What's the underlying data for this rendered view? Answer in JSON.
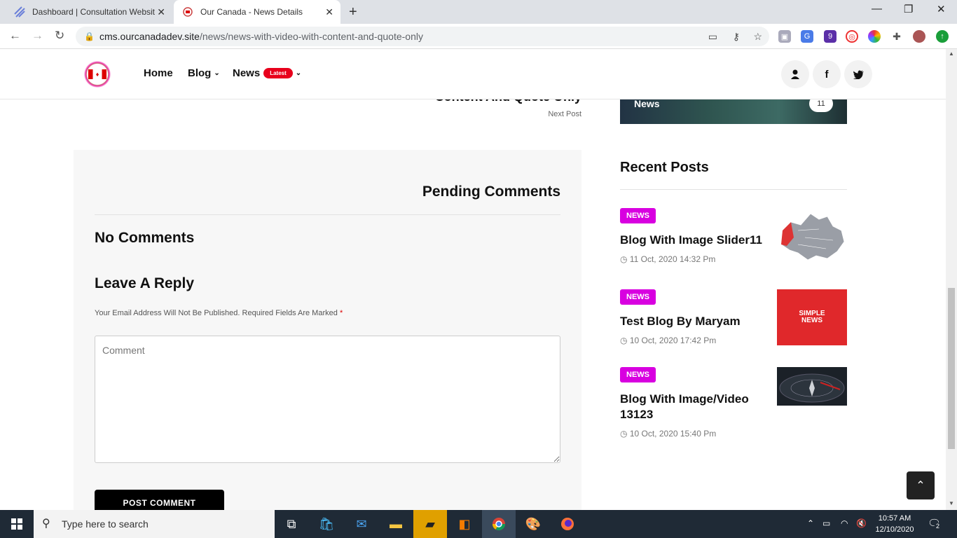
{
  "browser": {
    "tabs": [
      {
        "title": "Dashboard | Consultation Websit",
        "active": false
      },
      {
        "title": "Our Canada - News Details",
        "active": true
      }
    ],
    "url_host": "cms.ourcanadadev.site",
    "url_path": "/news/news-with-video-with-content-and-quote-only",
    "extension_badge": "9"
  },
  "header": {
    "nav": [
      {
        "label": "Home"
      },
      {
        "label": "Blog"
      },
      {
        "label": "News",
        "badge": "Latest"
      }
    ]
  },
  "next_post": {
    "title": "Content And Quote Only",
    "label": "Next Post"
  },
  "category_card": {
    "label": "News",
    "count": "11"
  },
  "comments": {
    "pending_title": "Pending Comments",
    "no_comments": "No Comments",
    "leave_reply": "Leave A Reply",
    "notice": "Your Email Address Will Not Be Published. Required Fields Are Marked",
    "required_mark": "*",
    "comment_placeholder": "Comment",
    "post_button": "POST COMMENT"
  },
  "recent": {
    "title": "Recent Posts",
    "posts": [
      {
        "tag": "NEWS",
        "title": "Blog With Image Slider11",
        "date": "11 Oct, 2020 14:32 Pm"
      },
      {
        "tag": "NEWS",
        "title": "Test Blog By Maryam",
        "date": "10 Oct, 2020 17:42 Pm",
        "thumb_text": "SIMPLE NEWS"
      },
      {
        "tag": "NEWS",
        "title": "Blog With Image/Video 13123",
        "date": "10 Oct, 2020 15:40 Pm"
      }
    ]
  },
  "taskbar": {
    "search_placeholder": "Type here to search",
    "time": "10:57 AM",
    "date": "12/10/2020",
    "notification_count": "2"
  }
}
